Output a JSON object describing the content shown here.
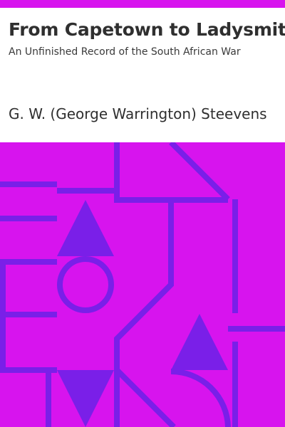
{
  "cover": {
    "title": "From Capetown to Ladysmith",
    "subtitle": "An Unfinished Record of the South African War",
    "author": "G. W. (George Warrington) Steevens"
  },
  "colors": {
    "accent": "#d714ee",
    "pattern": "#7a1fe8",
    "text": "#2f2f2f",
    "background": "#ffffff"
  }
}
